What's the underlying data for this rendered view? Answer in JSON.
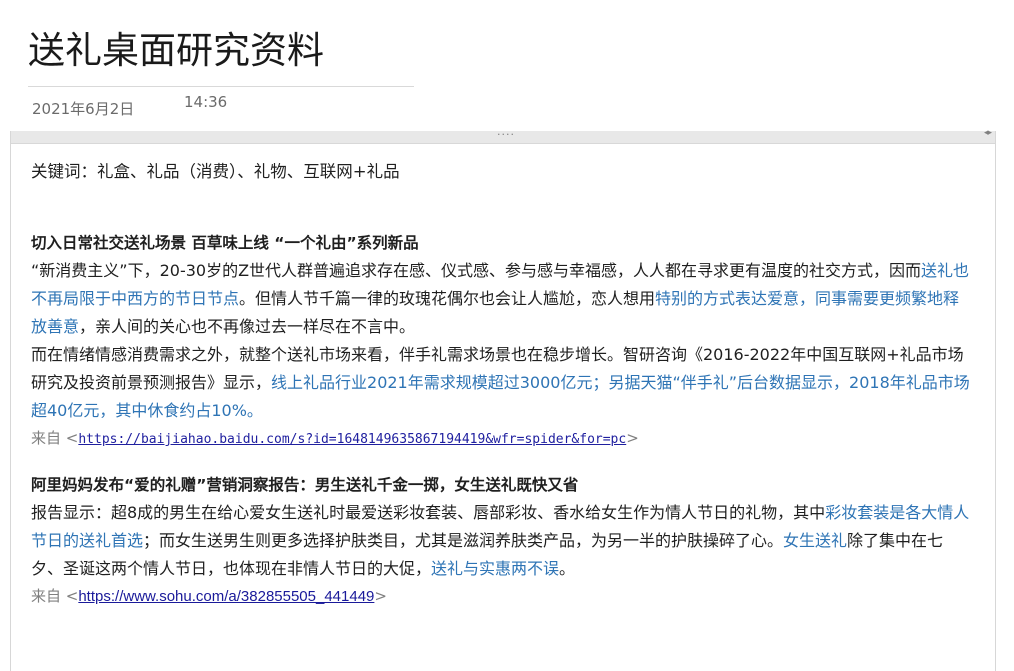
{
  "note": {
    "title": "送礼桌面研究资料",
    "date": "2021年6月2日",
    "time": "14:36"
  },
  "container": {
    "handle": "····",
    "resize_icon": "◂▸"
  },
  "keywords": "关键词：礼盒、礼品（消费）、礼物、互联网+礼品",
  "articles": [
    {
      "heading": "切入日常社交送礼场景 百草味上线 “一个礼由”系列新品",
      "p1": [
        {
          "t": "“新消费主义”下，20-30岁的Z世代人群普遍追求存在感、仪式感、参与感与幸福感，人人都在寻求更有温度的社交方式，因而",
          "h": false
        },
        {
          "t": "送礼也不再局限于中西方的节日节点",
          "h": true
        },
        {
          "t": "。但情人节千篇一律的玫瑰花偶尔也会让人尴尬，恋人想用",
          "h": false
        },
        {
          "t": "特别的方式表达爱意，同事需要更频繁地释放善意",
          "h": true
        },
        {
          "t": "，亲人间的关心也不再像过去一样尽在不言中。",
          "h": false
        }
      ],
      "p2": [
        {
          "t": "而在情绪情感消费需求之外，就整个送礼市场来看，伴手礼需求场景也在稳步增长。智研咨询《2016-2022年中国互联网+礼品市场研究及投资前景预测报告》显示，",
          "h": false
        },
        {
          "t": "线上礼品行业2021年需求规模超过3000亿元；另据天猫“伴手礼”后台数据显示，2018年礼品市场超40亿元，其中休食约占10%。",
          "h": true
        }
      ],
      "source_prefix": "来自 <",
      "source_url": "https://baijiahao.baidu.com/s?id=1648149635867194419&wfr=spider&for=pc",
      "source_suffix": ">"
    },
    {
      "heading": "阿里妈妈发布“爱的礼赠”营销洞察报告：男生送礼千金一掷，女生送礼既快又省",
      "p1": [
        {
          "t": "报告显示：超8成的男生在给心爱女生送礼时最爱送彩妆套装、唇部彩妆、香水给女生作为情人节日的礼物，其中",
          "h": false
        },
        {
          "t": "彩妆套装是各大情人节日的送礼首选",
          "h": true
        },
        {
          "t": "；而女生送男生则更多选择护肤类目，尤其是滋润养肤类产品，为另一半的护肤操碎了心。",
          "h": false
        },
        {
          "t": "女生送礼",
          "h": true
        },
        {
          "t": "除了集中在七夕、圣诞这两个情人节日，也体现在非情人节日的大促，",
          "h": false
        },
        {
          "t": "送礼与实惠两不误",
          "h": true
        },
        {
          "t": "。",
          "h": false
        }
      ],
      "source_prefix": "来自 <",
      "source_url": "https://www.sohu.com/a/382855505_441449",
      "source_suffix": ">"
    }
  ]
}
